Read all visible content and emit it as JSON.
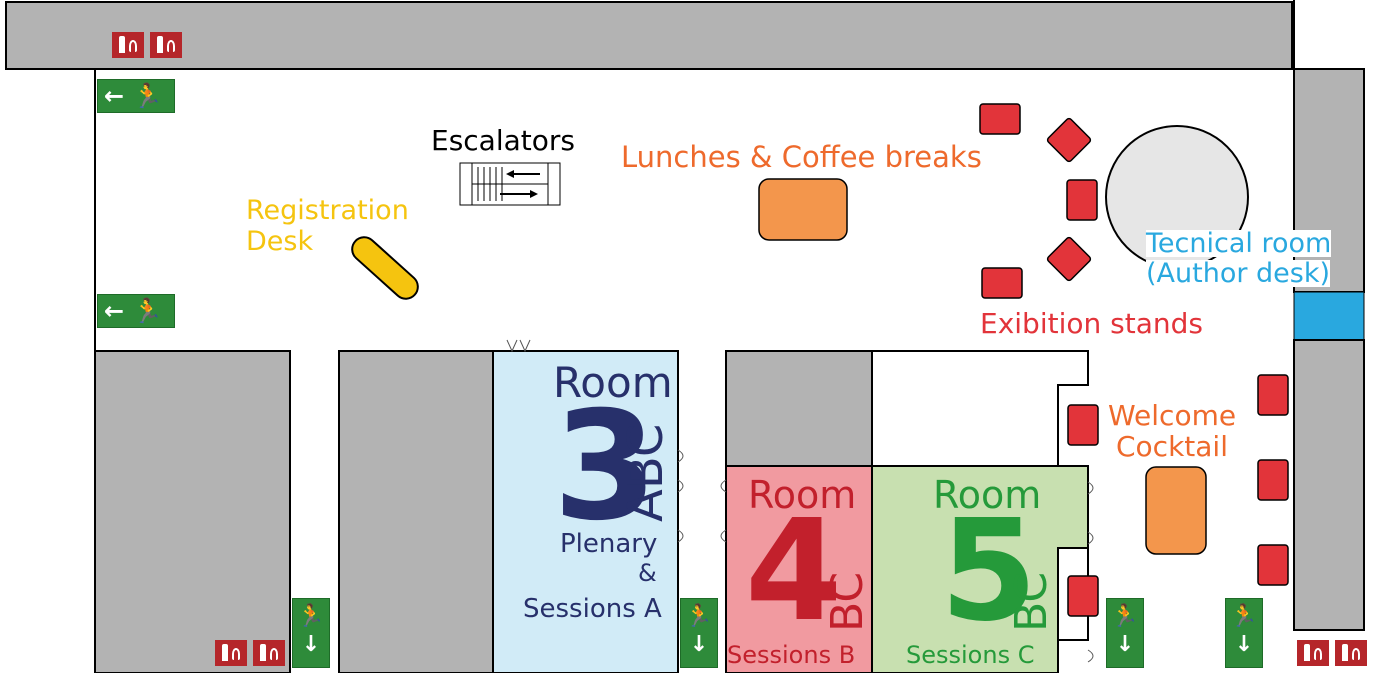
{
  "map": {
    "labels": {
      "escalators": "Escalators",
      "lunches": "Lunches & Coffee breaks",
      "registration_line1": "Registration",
      "registration_line2": "Desk",
      "technical_line1": "Tecnical room",
      "technical_line2": "(Author desk)",
      "exhibition": "Exibition stands",
      "welcome_line1": "Welcome",
      "welcome_line2": "Cocktail"
    },
    "rooms": {
      "room3": {
        "word": "Room",
        "number": "3",
        "letters": "ABC",
        "line1": "Plenary",
        "line2": "&",
        "line3": "Sessions A"
      },
      "room4": {
        "word": "Room",
        "number": "4",
        "letters": "BC",
        "sessions": "Sessions B"
      },
      "room5": {
        "word": "Room",
        "number": "5",
        "letters": "BC",
        "sessions": "Sessions C"
      }
    },
    "exit_signs": {
      "horizontal": "← 🏃",
      "vertical_top": "🏃",
      "vertical_arrow": "↓"
    },
    "colors": {
      "wall_gray": "#b3b3b3",
      "room3_fill": "#d1ebf7",
      "room3_text": "#27306b",
      "room4_fill": "#f19aa0",
      "room4_text": "#c2202c",
      "room5_fill": "#c8e0b0",
      "room5_text": "#259a3a",
      "stand_red": "#e2343a",
      "orange_label": "#ee6a2c",
      "orange_table": "#f3964c",
      "registration_yellow": "#f5c40f",
      "technical_blue": "#29a8df",
      "exit_green": "#2e8b3a",
      "fire_red": "#b5262a"
    }
  }
}
